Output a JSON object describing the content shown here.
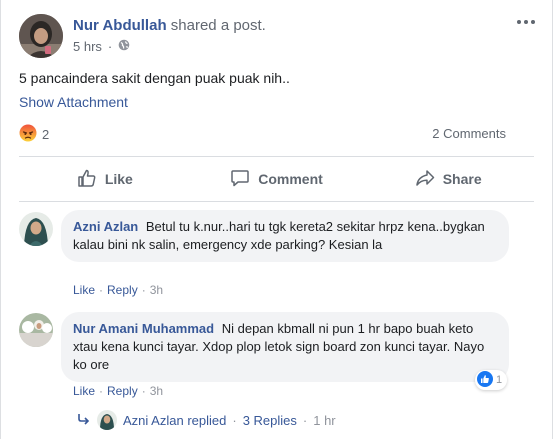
{
  "post": {
    "author": "Nur Abdullah",
    "action_text": "shared a post.",
    "time": "5 hrs",
    "separator": "·",
    "text": "5 pancaindera sakit dengan puak puak nih..",
    "show_attachment": "Show Attachment",
    "reaction_count": "2",
    "comments_count": "2 Comments"
  },
  "actions": {
    "like": "Like",
    "comment": "Comment",
    "share": "Share"
  },
  "comments": [
    {
      "author": "Azni Azlan",
      "text": "Betul tu k.nur..hari tu tgk kereta2 sekitar hrpz kena..bygkan kalau bini nk salin, emergency xde parking? Kesian la",
      "like": "Like",
      "reply": "Reply",
      "time": "3h",
      "dot": "·"
    },
    {
      "author": "Nur Amani Muhammad",
      "text": "Ni depan kbmall ni pun 1 hr bapo buah keto xtau kena kunci tayar. Xdop plop letok sign board zon kunci tayar. Nayo ko ore",
      "like": "Like",
      "reply": "Reply",
      "time": "3h",
      "dot": "·",
      "reaction_count": "1"
    }
  ],
  "replies": {
    "author_replied": "Azni Azlan replied",
    "dot": "·",
    "count_label": "3 Replies",
    "time": "1 hr"
  },
  "colors": {
    "link": "#385898",
    "muted": "#606770",
    "bubble": "#f2f3f5",
    "like_blue": "#1877f2",
    "angry": "#e9710f"
  },
  "icons": {
    "privacy": "globe-icon",
    "reaction": "angry-reaction-icon",
    "like": "thumbs-up-icon",
    "comment": "speech-bubble-icon",
    "share": "share-arrow-icon",
    "reply": "reply-arrow-icon"
  }
}
